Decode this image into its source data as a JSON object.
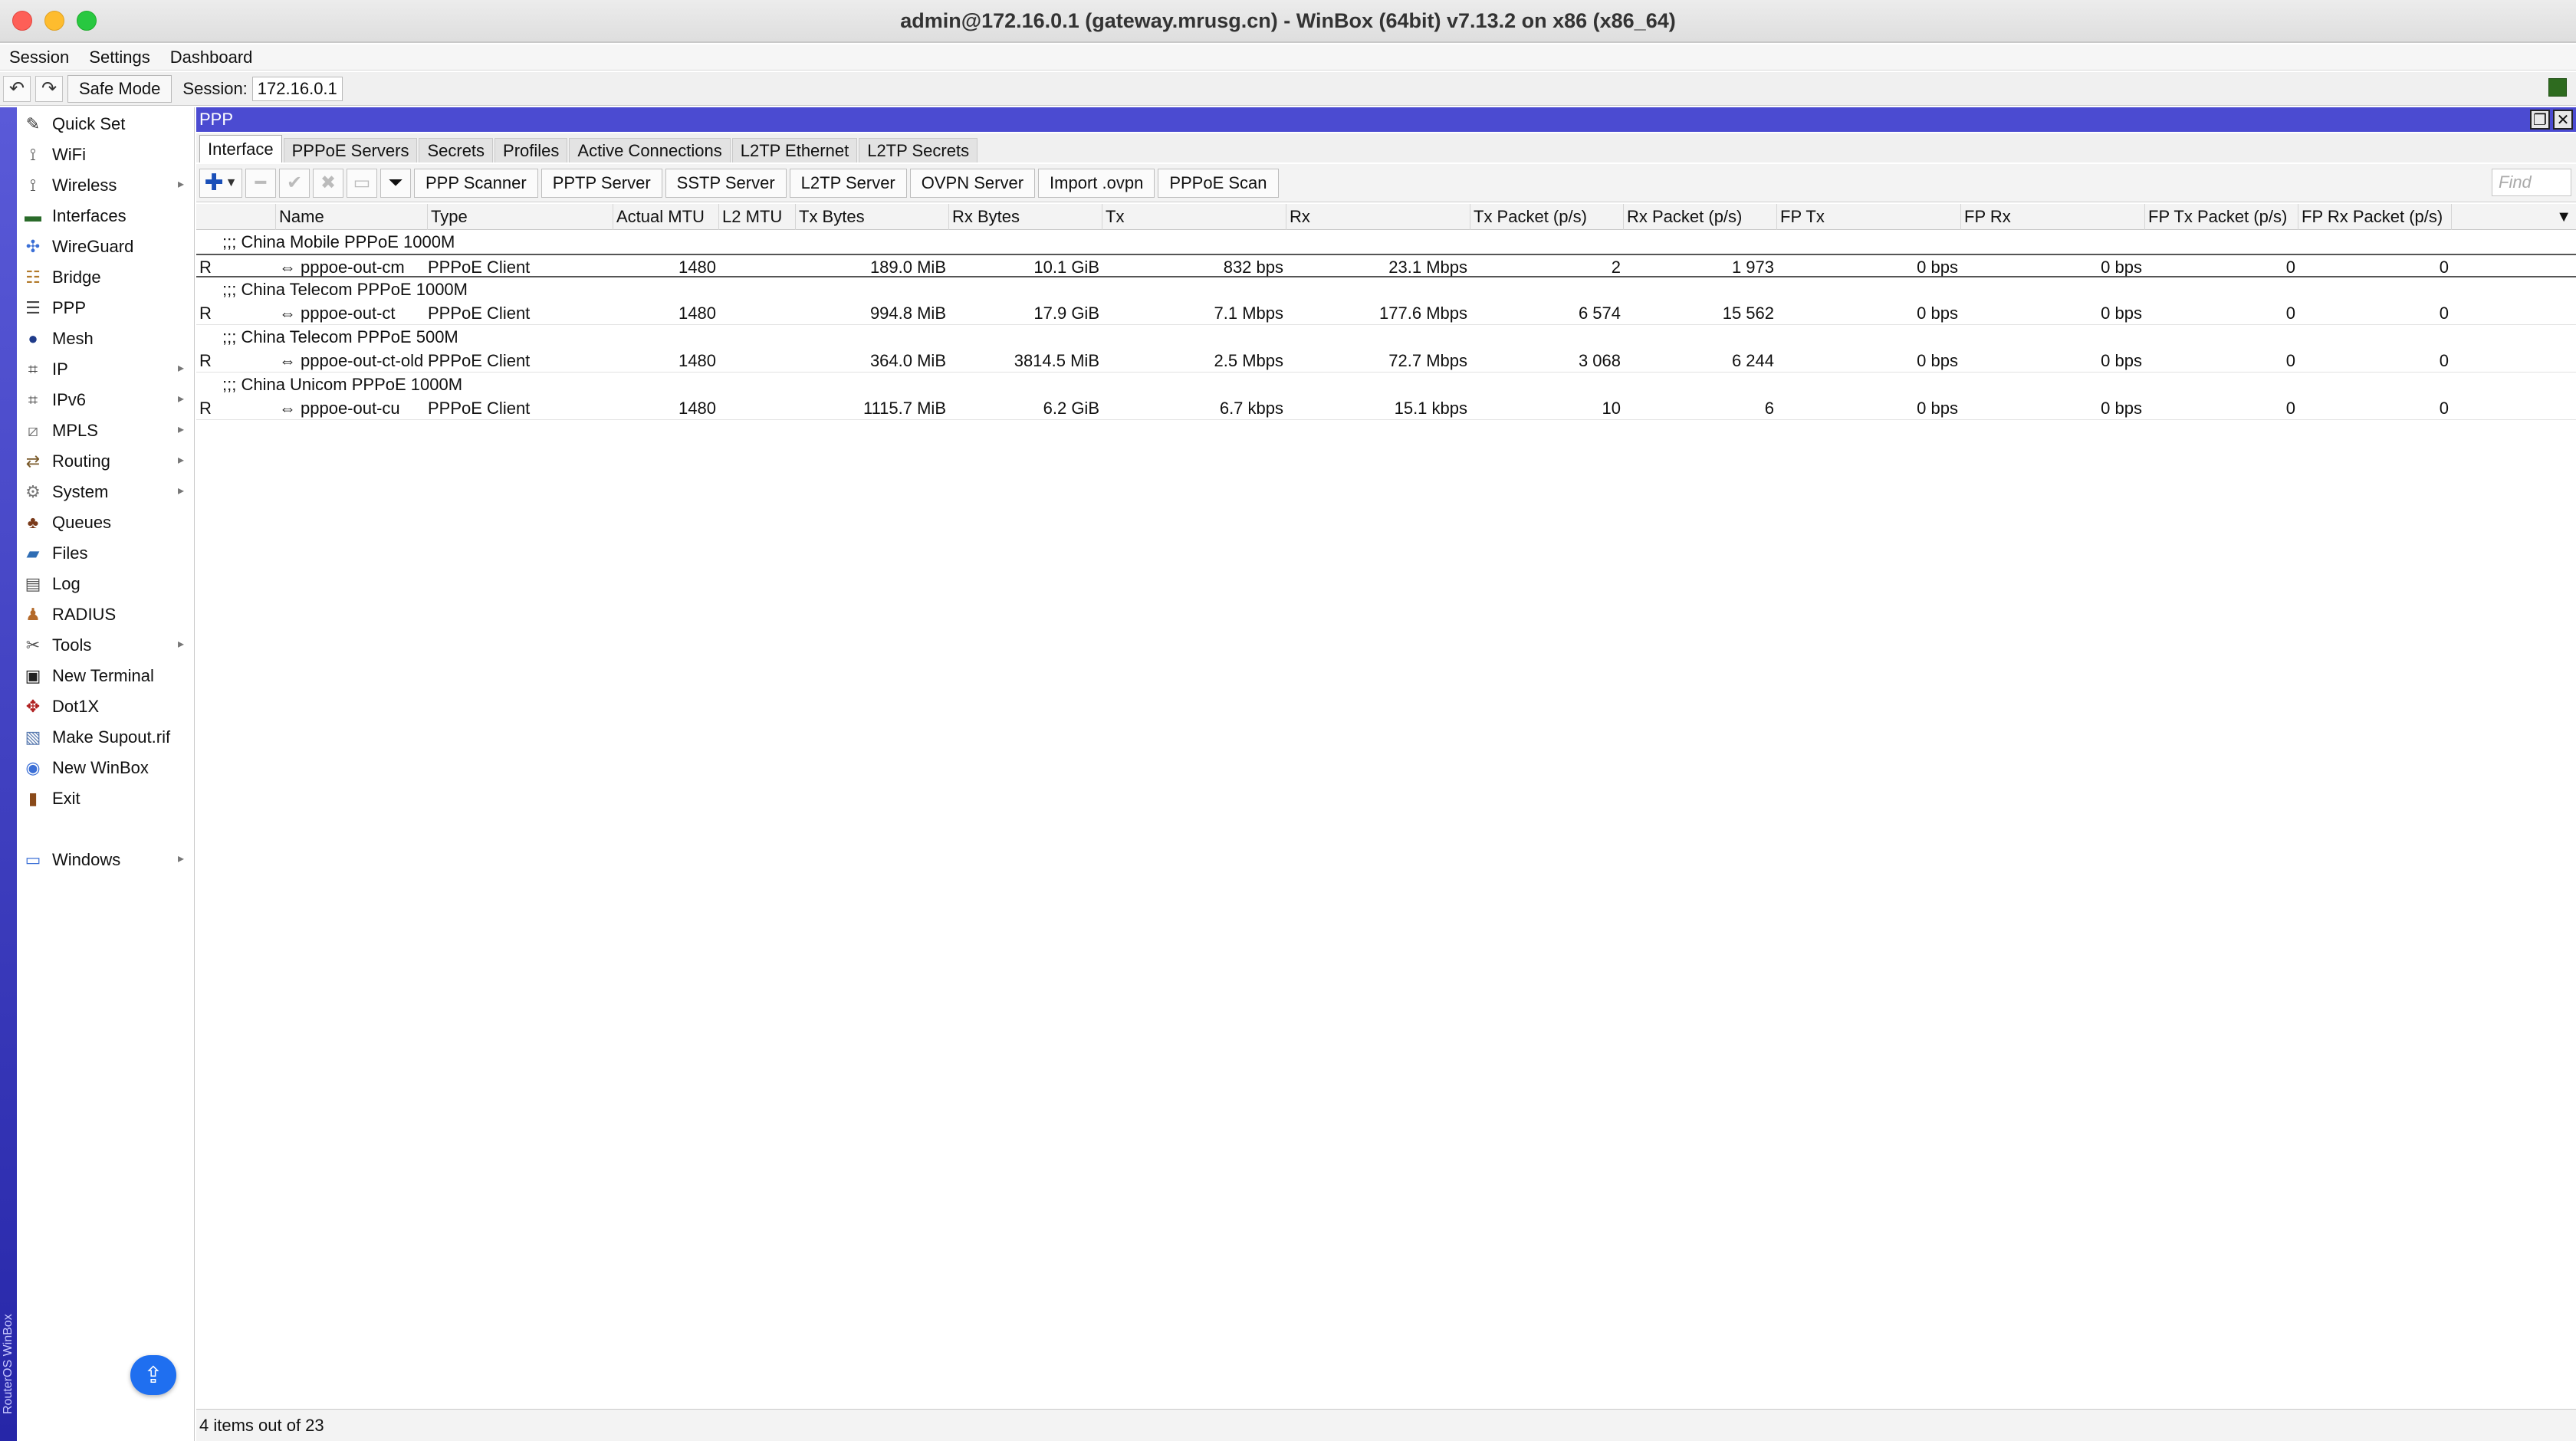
{
  "window": {
    "title": "admin@172.16.0.1 (gateway.mrusg.cn) - WinBox (64bit) v7.13.2 on x86 (x86_64)"
  },
  "menubar": [
    "Session",
    "Settings",
    "Dashboard"
  ],
  "toolbar": {
    "safe_mode": "Safe Mode",
    "session_label": "Session:",
    "session_value": "172.16.0.1"
  },
  "brand": "RouterOS WinBox",
  "sidebar": [
    {
      "label": "Quick Set",
      "icon": "magic-wand-icon",
      "glyph": "✎",
      "submenu": false
    },
    {
      "label": "WiFi",
      "icon": "antenna-icon",
      "glyph": "⟟",
      "submenu": false
    },
    {
      "label": "Wireless",
      "icon": "wireless-icon",
      "glyph": "⟟",
      "submenu": true
    },
    {
      "label": "Interfaces",
      "icon": "interfaces-icon",
      "glyph": "▬",
      "submenu": false
    },
    {
      "label": "WireGuard",
      "icon": "wireguard-icon",
      "glyph": "✣",
      "submenu": false
    },
    {
      "label": "Bridge",
      "icon": "bridge-icon",
      "glyph": "☷",
      "submenu": false
    },
    {
      "label": "PPP",
      "icon": "ppp-icon",
      "glyph": "☰",
      "submenu": false
    },
    {
      "label": "Mesh",
      "icon": "mesh-icon",
      "glyph": "●",
      "submenu": false
    },
    {
      "label": "IP",
      "icon": "ip-icon",
      "glyph": "⌗",
      "submenu": true
    },
    {
      "label": "IPv6",
      "icon": "ipv6-icon",
      "glyph": "⌗",
      "submenu": true
    },
    {
      "label": "MPLS",
      "icon": "mpls-icon",
      "glyph": "⧄",
      "submenu": true
    },
    {
      "label": "Routing",
      "icon": "routing-icon",
      "glyph": "⇄",
      "submenu": true
    },
    {
      "label": "System",
      "icon": "gear-icon",
      "glyph": "⚙",
      "submenu": true
    },
    {
      "label": "Queues",
      "icon": "queues-icon",
      "glyph": "♣",
      "submenu": false
    },
    {
      "label": "Files",
      "icon": "folder-icon",
      "glyph": "▰",
      "submenu": false
    },
    {
      "label": "Log",
      "icon": "log-icon",
      "glyph": "▤",
      "submenu": false
    },
    {
      "label": "RADIUS",
      "icon": "radius-icon",
      "glyph": "♟",
      "submenu": false
    },
    {
      "label": "Tools",
      "icon": "tools-icon",
      "glyph": "✂",
      "submenu": true
    },
    {
      "label": "New Terminal",
      "icon": "terminal-icon",
      "glyph": "▣",
      "submenu": false
    },
    {
      "label": "Dot1X",
      "icon": "dot1x-icon",
      "glyph": "✥",
      "submenu": false
    },
    {
      "label": "Make Supout.rif",
      "icon": "supout-icon",
      "glyph": "▧",
      "submenu": false
    },
    {
      "label": "New WinBox",
      "icon": "winbox-icon",
      "glyph": "◉",
      "submenu": false
    },
    {
      "label": "Exit",
      "icon": "exit-icon",
      "glyph": "▮",
      "submenu": false
    },
    {
      "label": "Windows",
      "icon": "windows-icon",
      "glyph": "▭",
      "submenu": true
    }
  ],
  "ppp": {
    "title": "PPP",
    "tabs": [
      "Interface",
      "PPPoE Servers",
      "Secrets",
      "Profiles",
      "Active Connections",
      "L2TP Ethernet",
      "L2TP Secrets"
    ],
    "buttons": [
      "PPP Scanner",
      "PPTP Server",
      "SSTP Server",
      "L2TP Server",
      "OVPN Server",
      "Import .ovpn",
      "PPPoE Scan"
    ],
    "find_placeholder": "Find",
    "columns": [
      "Name",
      "Type",
      "Actual MTU",
      "L2 MTU",
      "Tx Bytes",
      "Rx Bytes",
      "Tx",
      "Rx",
      "Tx Packet (p/s)",
      "Rx Packet (p/s)",
      "FP Tx",
      "FP Rx",
      "FP Tx Packet (p/s)",
      "FP Rx Packet (p/s)"
    ],
    "rows": [
      {
        "comment": ";;; China Mobile PPPoE 1000M",
        "flag": "R",
        "name": "pppoe-out-cm",
        "type": "PPPoE Client",
        "actual_mtu": "1480",
        "l2_mtu": "",
        "tx_bytes": "189.0 MiB",
        "rx_bytes": "10.1 GiB",
        "tx": "832 bps",
        "rx": "23.1 Mbps",
        "tx_pps": "2",
        "rx_pps": "1 973",
        "fp_tx": "0 bps",
        "fp_rx": "0 bps",
        "fp_tx_pps": "0",
        "fp_rx_pps": "0"
      },
      {
        "comment": ";;; China Telecom PPPoE 1000M",
        "flag": "R",
        "name": "pppoe-out-ct",
        "type": "PPPoE Client",
        "actual_mtu": "1480",
        "l2_mtu": "",
        "tx_bytes": "994.8 MiB",
        "rx_bytes": "17.9 GiB",
        "tx": "7.1 Mbps",
        "rx": "177.6 Mbps",
        "tx_pps": "6 574",
        "rx_pps": "15 562",
        "fp_tx": "0 bps",
        "fp_rx": "0 bps",
        "fp_tx_pps": "0",
        "fp_rx_pps": "0"
      },
      {
        "comment": ";;; China Telecom PPPoE 500M",
        "flag": "R",
        "name": "pppoe-out-ct-old",
        "type": "PPPoE Client",
        "actual_mtu": "1480",
        "l2_mtu": "",
        "tx_bytes": "364.0 MiB",
        "rx_bytes": "3814.5 MiB",
        "tx": "2.5 Mbps",
        "rx": "72.7 Mbps",
        "tx_pps": "3 068",
        "rx_pps": "6 244",
        "fp_tx": "0 bps",
        "fp_rx": "0 bps",
        "fp_tx_pps": "0",
        "fp_rx_pps": "0"
      },
      {
        "comment": ";;; China Unicom PPPoE 1000M",
        "flag": "R",
        "name": "pppoe-out-cu",
        "type": "PPPoE Client",
        "actual_mtu": "1480",
        "l2_mtu": "",
        "tx_bytes": "1115.7 MiB",
        "rx_bytes": "6.2 GiB",
        "tx": "6.7 kbps",
        "rx": "15.1 kbps",
        "tx_pps": "10",
        "rx_pps": "6",
        "fp_tx": "0 bps",
        "fp_rx": "0 bps",
        "fp_tx_pps": "0",
        "fp_rx_pps": "0"
      }
    ],
    "status": "4 items out of 23"
  }
}
